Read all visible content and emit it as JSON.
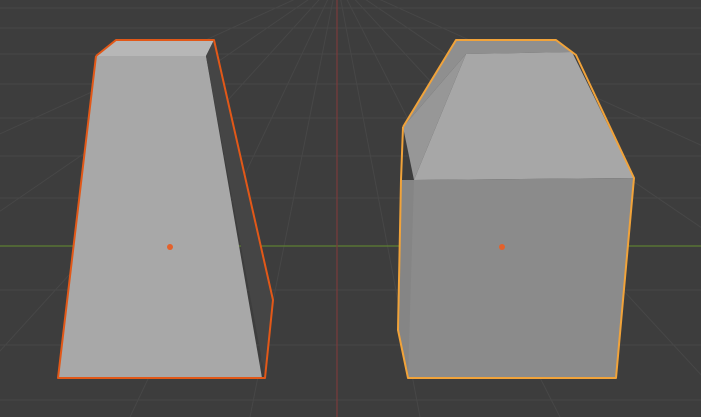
{
  "viewport": {
    "background_color": "#3d3d3d",
    "grid_color": "#474747",
    "x_axis_color": "#5e7f32",
    "y_axis_color": "#7a3b3b"
  },
  "objects": [
    {
      "kind": "selected-object",
      "status": "selected",
      "outline_color": "#e25818"
    },
    {
      "kind": "selected-object",
      "status": "active",
      "outline_color": "#f1a33a"
    }
  ],
  "origin_color": "#e4612b"
}
